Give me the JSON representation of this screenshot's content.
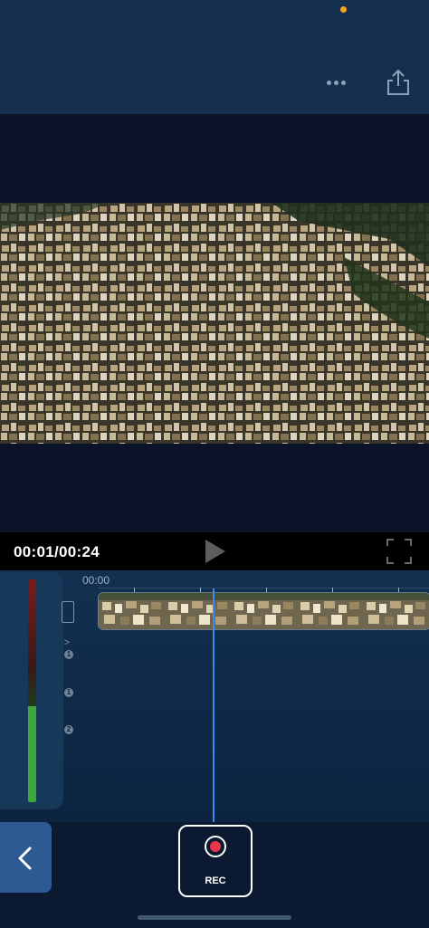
{
  "header": {
    "more_icon": "more-horizontal-icon",
    "share_icon": "share-upload-icon"
  },
  "player": {
    "time": "00:01/00:24",
    "play_icon": "play-icon",
    "fullscreen_icon": "fullscreen-icon"
  },
  "timeline": {
    "ruler_start": "00:00",
    "track_badges": [
      "1",
      "1",
      "2"
    ],
    "audio_level_fraction": 0.43
  },
  "bottom": {
    "back_icon": "chevron-left-icon",
    "rec_label": "REC"
  },
  "colors": {
    "accent": "#3b8cf0",
    "record": "#e8364a",
    "status_dot": "#f5a623",
    "back_button": "#2e5a94"
  }
}
